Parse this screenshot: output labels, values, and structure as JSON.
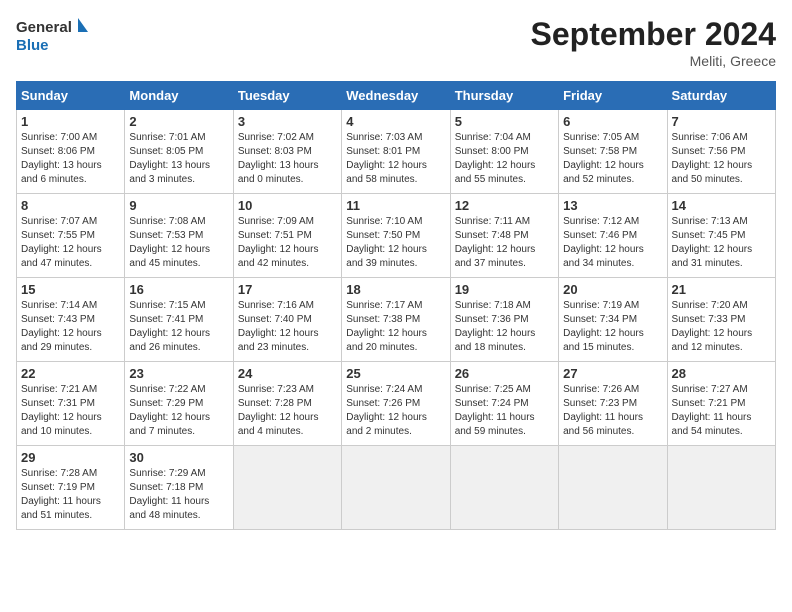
{
  "header": {
    "logo_line1": "General",
    "logo_line2": "Blue",
    "month": "September 2024",
    "location": "Meliti, Greece"
  },
  "weekdays": [
    "Sunday",
    "Monday",
    "Tuesday",
    "Wednesday",
    "Thursday",
    "Friday",
    "Saturday"
  ],
  "weeks": [
    [
      {
        "day": "1",
        "info": "Sunrise: 7:00 AM\nSunset: 8:06 PM\nDaylight: 13 hours\nand 6 minutes."
      },
      {
        "day": "2",
        "info": "Sunrise: 7:01 AM\nSunset: 8:05 PM\nDaylight: 13 hours\nand 3 minutes."
      },
      {
        "day": "3",
        "info": "Sunrise: 7:02 AM\nSunset: 8:03 PM\nDaylight: 13 hours\nand 0 minutes."
      },
      {
        "day": "4",
        "info": "Sunrise: 7:03 AM\nSunset: 8:01 PM\nDaylight: 12 hours\nand 58 minutes."
      },
      {
        "day": "5",
        "info": "Sunrise: 7:04 AM\nSunset: 8:00 PM\nDaylight: 12 hours\nand 55 minutes."
      },
      {
        "day": "6",
        "info": "Sunrise: 7:05 AM\nSunset: 7:58 PM\nDaylight: 12 hours\nand 52 minutes."
      },
      {
        "day": "7",
        "info": "Sunrise: 7:06 AM\nSunset: 7:56 PM\nDaylight: 12 hours\nand 50 minutes."
      }
    ],
    [
      {
        "day": "8",
        "info": "Sunrise: 7:07 AM\nSunset: 7:55 PM\nDaylight: 12 hours\nand 47 minutes."
      },
      {
        "day": "9",
        "info": "Sunrise: 7:08 AM\nSunset: 7:53 PM\nDaylight: 12 hours\nand 45 minutes."
      },
      {
        "day": "10",
        "info": "Sunrise: 7:09 AM\nSunset: 7:51 PM\nDaylight: 12 hours\nand 42 minutes."
      },
      {
        "day": "11",
        "info": "Sunrise: 7:10 AM\nSunset: 7:50 PM\nDaylight: 12 hours\nand 39 minutes."
      },
      {
        "day": "12",
        "info": "Sunrise: 7:11 AM\nSunset: 7:48 PM\nDaylight: 12 hours\nand 37 minutes."
      },
      {
        "day": "13",
        "info": "Sunrise: 7:12 AM\nSunset: 7:46 PM\nDaylight: 12 hours\nand 34 minutes."
      },
      {
        "day": "14",
        "info": "Sunrise: 7:13 AM\nSunset: 7:45 PM\nDaylight: 12 hours\nand 31 minutes."
      }
    ],
    [
      {
        "day": "15",
        "info": "Sunrise: 7:14 AM\nSunset: 7:43 PM\nDaylight: 12 hours\nand 29 minutes."
      },
      {
        "day": "16",
        "info": "Sunrise: 7:15 AM\nSunset: 7:41 PM\nDaylight: 12 hours\nand 26 minutes."
      },
      {
        "day": "17",
        "info": "Sunrise: 7:16 AM\nSunset: 7:40 PM\nDaylight: 12 hours\nand 23 minutes."
      },
      {
        "day": "18",
        "info": "Sunrise: 7:17 AM\nSunset: 7:38 PM\nDaylight: 12 hours\nand 20 minutes."
      },
      {
        "day": "19",
        "info": "Sunrise: 7:18 AM\nSunset: 7:36 PM\nDaylight: 12 hours\nand 18 minutes."
      },
      {
        "day": "20",
        "info": "Sunrise: 7:19 AM\nSunset: 7:34 PM\nDaylight: 12 hours\nand 15 minutes."
      },
      {
        "day": "21",
        "info": "Sunrise: 7:20 AM\nSunset: 7:33 PM\nDaylight: 12 hours\nand 12 minutes."
      }
    ],
    [
      {
        "day": "22",
        "info": "Sunrise: 7:21 AM\nSunset: 7:31 PM\nDaylight: 12 hours\nand 10 minutes."
      },
      {
        "day": "23",
        "info": "Sunrise: 7:22 AM\nSunset: 7:29 PM\nDaylight: 12 hours\nand 7 minutes."
      },
      {
        "day": "24",
        "info": "Sunrise: 7:23 AM\nSunset: 7:28 PM\nDaylight: 12 hours\nand 4 minutes."
      },
      {
        "day": "25",
        "info": "Sunrise: 7:24 AM\nSunset: 7:26 PM\nDaylight: 12 hours\nand 2 minutes."
      },
      {
        "day": "26",
        "info": "Sunrise: 7:25 AM\nSunset: 7:24 PM\nDaylight: 11 hours\nand 59 minutes."
      },
      {
        "day": "27",
        "info": "Sunrise: 7:26 AM\nSunset: 7:23 PM\nDaylight: 11 hours\nand 56 minutes."
      },
      {
        "day": "28",
        "info": "Sunrise: 7:27 AM\nSunset: 7:21 PM\nDaylight: 11 hours\nand 54 minutes."
      }
    ],
    [
      {
        "day": "29",
        "info": "Sunrise: 7:28 AM\nSunset: 7:19 PM\nDaylight: 11 hours\nand 51 minutes."
      },
      {
        "day": "30",
        "info": "Sunrise: 7:29 AM\nSunset: 7:18 PM\nDaylight: 11 hours\nand 48 minutes."
      },
      {
        "day": "",
        "info": ""
      },
      {
        "day": "",
        "info": ""
      },
      {
        "day": "",
        "info": ""
      },
      {
        "day": "",
        "info": ""
      },
      {
        "day": "",
        "info": ""
      }
    ]
  ]
}
